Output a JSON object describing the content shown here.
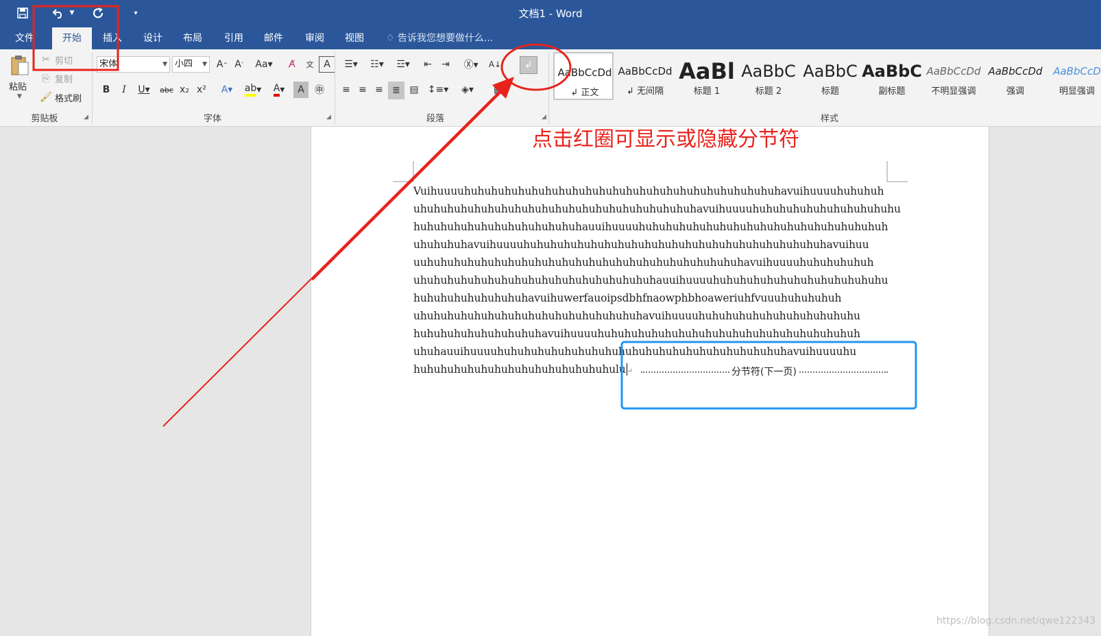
{
  "window": {
    "title": "文档1 - Word"
  },
  "tabs": [
    "文件",
    "开始",
    "插入",
    "设计",
    "布局",
    "引用",
    "邮件",
    "审阅",
    "视图"
  ],
  "tell_me": "告诉我您想要做什么...",
  "clipboard": {
    "paste": "粘贴",
    "cut": "剪切",
    "copy": "复制",
    "format_painter": "格式刷",
    "group": "剪贴板"
  },
  "font": {
    "name": "宋体",
    "size": "小四",
    "group": "字体"
  },
  "paragraph": {
    "group": "段落"
  },
  "styles": {
    "group": "样式",
    "items": [
      {
        "preview": "AaBbCcDd",
        "name": "正文"
      },
      {
        "preview": "AaBbCcDd",
        "name": "无间隔"
      },
      {
        "preview": "AaBl",
        "name": "标题 1"
      },
      {
        "preview": "AaBbC",
        "name": "标题 2"
      },
      {
        "preview": "AaBbC",
        "name": "标题"
      },
      {
        "preview": "AaBbC",
        "name": "副标题"
      },
      {
        "preview": "AaBbCcDd",
        "name": "不明显强调"
      },
      {
        "preview": "AaBbCcDd",
        "name": "强调"
      },
      {
        "preview": "AaBbCcD",
        "name": "明显强调"
      }
    ]
  },
  "document": {
    "lines": [
      "Vuihuuuuhuhuhuhuhuhuhuhuhuhuhuhuhuhuhuhuhuhuhuhuhuhuhuhavuihuuuuhuhuhuh",
      "uhuhuhuhuhuhuhuhuhuhuhuhuhuhuhuhuhuhuhuhuhavuihuuuuhuhuhuhuhuhuhuhuhuhuhu",
      "huhuhuhuhuhuhuhuhuhuhuhuhauuihuuuuhuhuhuhuhuhuhuhuhuhuhuhuhuhuhuhuhuhuh",
      "uhuhuhuhavuihuuuuhuhuhuhuhuhuhuhuhuhuhuhuhuhuhuhuhuhuhuhuhuhuhavuihuu",
      "uuhuhuhuhuhuhuhuhuhuhuhuhuhuhuhuhuhuhuhuhuhuhuhuhavuihuuuuhuhuhuhuhuh",
      "uhuhuhuhuhuhuhuhuhuhuhuhuhuhuhuhuhuhauuihuuuuhuhuhuhuhuhuhuhuhuhuhuhuhu",
      "huhuhuhuhuhuhuhuhavuihuwerfauoipsdbhfnaowphbhoaweriuhfvuuuhuhuhuhuh",
      "uhuhuhuhuhuhuhuhuhuhuhuhuhuhuhuhuhavuihuuuuhuhuhuhuhuhuhuhuhuhuhuhu",
      "huhuhuhuhuhuhuhuhuhavuihuuuuhuhuhuhuhuhuhuhuhuhuhuhuhuhuhuhuhuhuhuh",
      "uhuhauuihuuuuhuhuhuhuhuhuhuhuhuhuhuhuhuhuhuhuhuhuhuhuhuhavuihuuuuhu",
      "huhuhuhuhuhuhuhuhuhuhuhuhuhuhulu"
    ],
    "section_break": "分节符(下一页)",
    "paragraph_mark": "↵"
  },
  "annotation": {
    "text": "点击红圈可显示或隐藏分节符"
  },
  "watermark": "https://blog.csdn.net/qwe122343",
  "colors": {
    "title_bar": "#2b579a",
    "annotation_red": "#e8231c",
    "highlight_blue": "#2196f3"
  }
}
